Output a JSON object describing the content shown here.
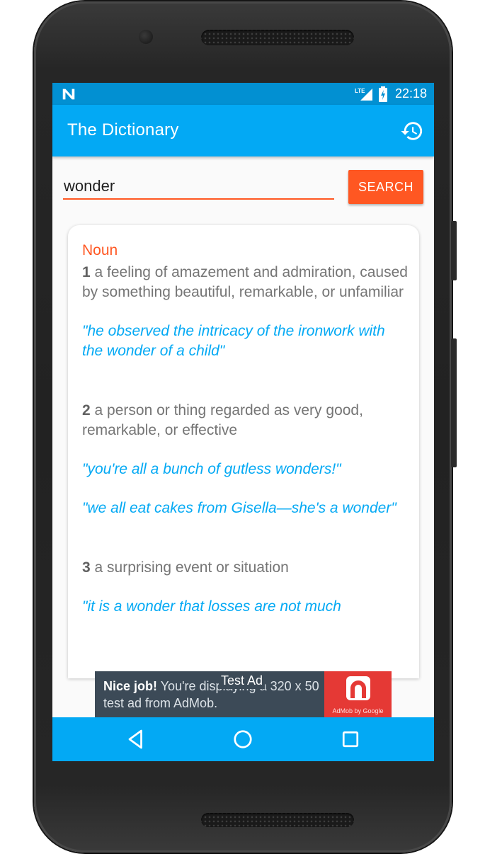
{
  "status_bar": {
    "network_label": "LTE",
    "time": "22:18",
    "icons": [
      "notification-n-icon",
      "signal-icon",
      "battery-charging-icon"
    ]
  },
  "app_bar": {
    "title": "The Dictionary",
    "history_icon": "history-icon"
  },
  "search": {
    "value": "wonder",
    "button_label": "SEARCH"
  },
  "entry": {
    "part_of_speech": "Noun",
    "senses": [
      {
        "number": "1",
        "definition": "a feeling of amazement and admiration, caused by something beautiful, remarkable, or unfamiliar",
        "examples": [
          "\"he observed the intricacy of the ironwork with the wonder of a child\""
        ]
      },
      {
        "number": "2",
        "definition": "a person or thing regarded as very good, remarkable, or effective",
        "examples": [
          "\"you're all a bunch of gutless wonders!\"",
          "\"we all eat cakes from Gisella—she's a wonder\""
        ]
      },
      {
        "number": "3",
        "definition": "a surprising event or situation",
        "examples": [
          "\"it is a wonder that losses are not much"
        ]
      }
    ]
  },
  "ad": {
    "headline": "Nice job!",
    "body": "You're displaying a 320 x 50 test ad from AdMob.",
    "brand": "AdMob by Google",
    "test_label": "Test Ad"
  },
  "nav_bar": {
    "icons": [
      "back-icon",
      "home-icon",
      "recents-icon"
    ]
  },
  "colors": {
    "primary": "#03a9f4",
    "primary_dark": "#0290d2",
    "accent": "#ff5722",
    "definition_text": "#757575",
    "example_text": "#03a9f4",
    "ad_background": "#3c4a57",
    "admob_red": "#e53935"
  }
}
